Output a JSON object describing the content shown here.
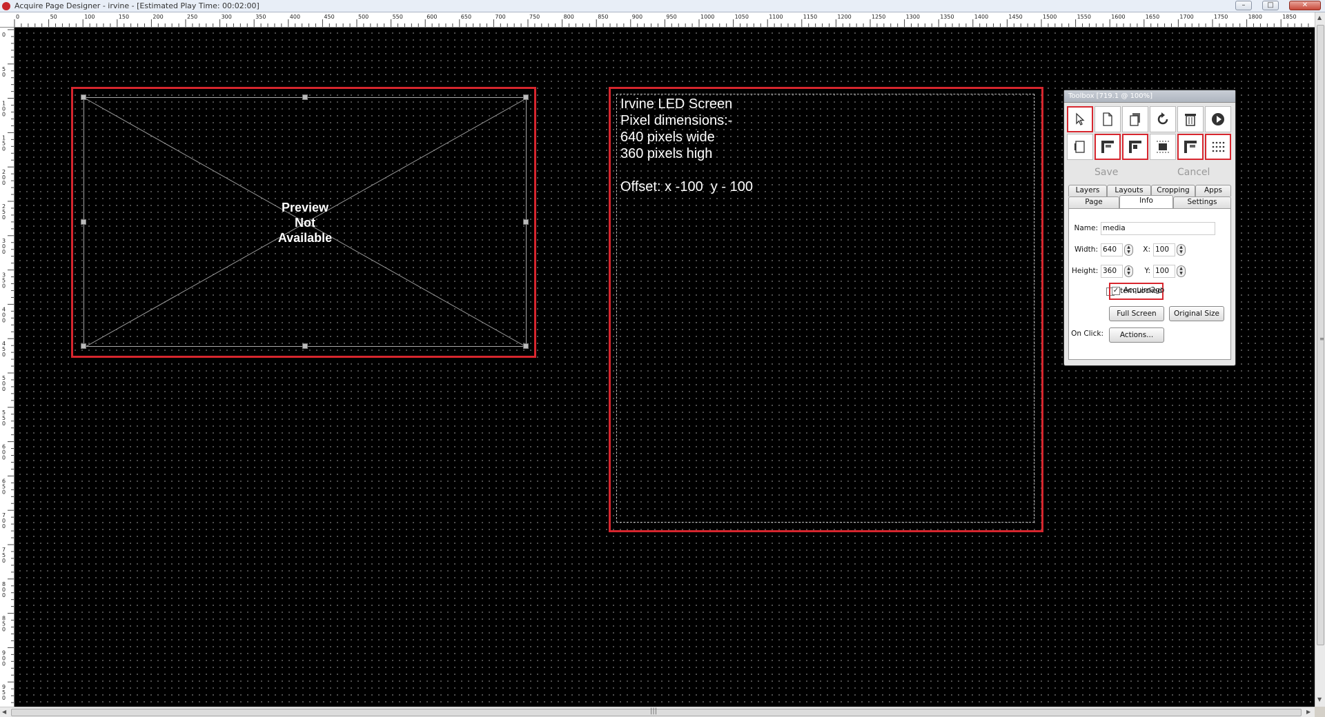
{
  "window": {
    "title": "Acquire Page Designer - irvine - [Estimated Play Time: 00:02:00]",
    "minimize": "–",
    "maximize": "□",
    "close": "✕"
  },
  "ruler_top": [
    "0",
    "50",
    "100",
    "150",
    "200",
    "250",
    "300",
    "350",
    "400",
    "450",
    "500",
    "550",
    "600",
    "650",
    "700",
    "750",
    "800",
    "850",
    "900",
    "950",
    "1000",
    "1050",
    "1100",
    "1150",
    "1200",
    "1250",
    "1300",
    "1350",
    "1400",
    "1450",
    "1500",
    "1550",
    "1600",
    "1650",
    "1700",
    "1750",
    "1800",
    "1850"
  ],
  "ruler_left": [
    "0",
    "50",
    "100",
    "150",
    "200",
    "250",
    "300",
    "350",
    "400",
    "450",
    "500",
    "550",
    "600",
    "650",
    "700",
    "750",
    "800",
    "850",
    "900",
    "950"
  ],
  "media": {
    "placeholder": "Preview\nNot\nAvailable"
  },
  "text_item": {
    "lines": [
      "Irvine LED Screen",
      "Pixel dimensions:-",
      "640 pixels wide",
      "360 pixels high",
      "",
      "Offset: x -100  y - 100"
    ]
  },
  "toolbox": {
    "title": "Toolbox [719.1 @ 100%]",
    "save": "Save",
    "cancel": "Cancel",
    "tabs": {
      "layers": "Layers",
      "layouts": "Layouts",
      "cropping": "Cropping",
      "apps": "Apps",
      "page": "Page",
      "info": "Info",
      "settings": "Settings"
    },
    "name_label": "Name:",
    "name_value": "media",
    "width_label": "Width:",
    "width_value": "640",
    "height_label": "Height:",
    "height_value": "360",
    "x_label": "X:",
    "x_value": "100",
    "y_label": "Y:",
    "y_value": "100",
    "item_locked": "Item Locked",
    "item_locked_checked": false,
    "acquire2go": "Acquire2go",
    "acquire2go_checked": true,
    "full_screen": "Full Screen",
    "original_size": "Original Size",
    "on_click_label": "On Click:",
    "actions": "Actions..."
  },
  "scroll": {
    "up": "▲",
    "down": "▼",
    "left": "◀",
    "right": "▶",
    "grip_v": "≡",
    "grip_h": "|||"
  },
  "icons": [
    "pointer-icon",
    "new-page-icon",
    "copy-icon",
    "undo-icon",
    "delete-icon",
    "play-icon",
    "insert-icon",
    "align-top-left-icon",
    "align-top-center-icon",
    "align-middle-icon",
    "align-top-right-icon",
    "grid-icon"
  ]
}
